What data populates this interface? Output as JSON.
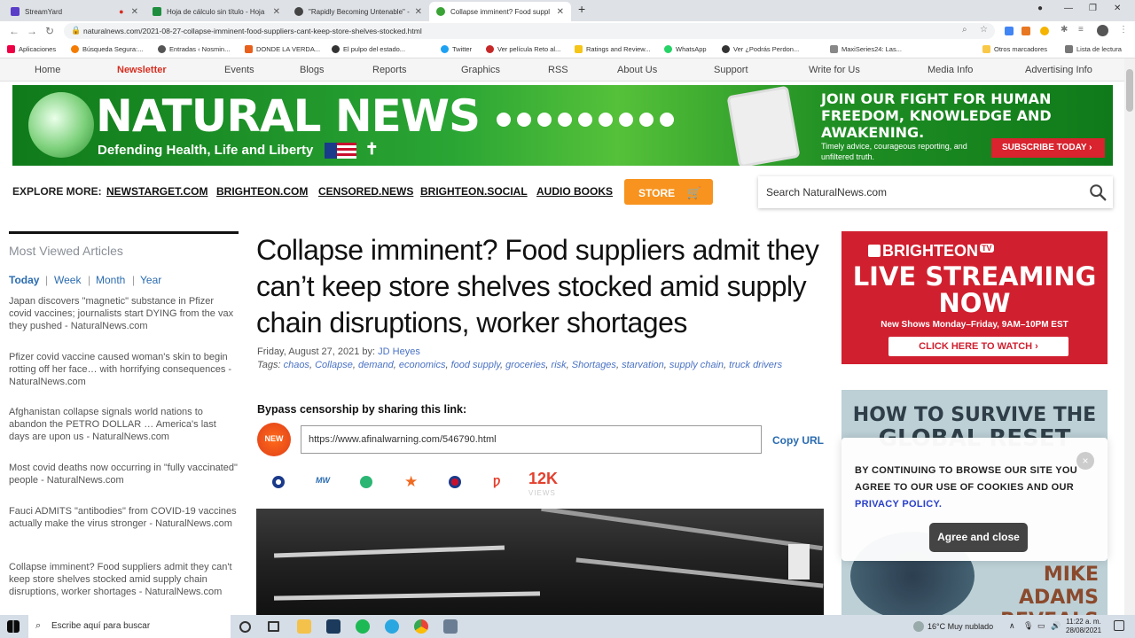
{
  "browser": {
    "tabs": [
      {
        "title": "StreamYard",
        "color": "#5a3ec8"
      },
      {
        "title": "Hoja de cálculo sin título - Hoja",
        "color": "#1e8e3e"
      },
      {
        "title": "\"Rapidly Becoming Untenable\" -",
        "color": "#444444"
      },
      {
        "title": "Collapse imminent? Food suppl",
        "color": "#3aa335"
      }
    ],
    "url": "naturalnews.com/2021-08-27-collapse-imminent-food-suppliers-cant-keep-store-shelves-stocked.html",
    "bookmarks": [
      "Aplicaciones",
      "Búsqueda Segura:...",
      "Entradas ‹ Nosmin...",
      "DONDE LA VERDA...",
      "El pulpo del estado...",
      "Twitter",
      "Ver película Reto al...",
      "Ratings and Review...",
      "WhatsApp",
      "Ver ¿Podrás Perdon...",
      "MaxiSeries24: Las...",
      "Otros marcadores",
      "Lista de lectura"
    ]
  },
  "site_nav": [
    "Home",
    "Newsletter",
    "Events",
    "Blogs",
    "Reports",
    "Graphics",
    "RSS",
    "About Us",
    "Support",
    "Write for Us",
    "Media Info",
    "Advertising Info"
  ],
  "banner": {
    "logo": "NATURAL NEWS",
    "tagline": "Defending Health, Life and Liberty",
    "promo_title": "JOIN OUR FIGHT FOR HUMAN FREEDOM, KNOWLEDGE AND AWAKENING.",
    "promo_sub": "Timely advice, courageous reporting, and unfiltered truth.",
    "subscribe": "SUBSCRIBE TODAY ›"
  },
  "explore": {
    "label": "EXPLORE MORE:",
    "links": [
      "NEWSTARGET.COM",
      "BRIGHTEON.COM",
      "CENSORED.NEWS",
      "BRIGHTEON.SOCIAL",
      "AUDIO BOOKS"
    ],
    "store": "STORE"
  },
  "search": {
    "placeholder": "Search NaturalNews.com"
  },
  "sidebar": {
    "title": "Most Viewed Articles",
    "tabs": [
      "Today",
      "Week",
      "Month",
      "Year"
    ],
    "items": [
      "Japan discovers \"magnetic\" substance in Pfizer covid vaccines; journalists start DYING from the vax they pushed - NaturalNews.com",
      "Pfizer covid vaccine caused woman's skin to begin rotting off her face… with horrifying consequences - NaturalNews.com",
      "Afghanistan collapse signals world nations to abandon the PETRO DOLLAR … America's last days are upon us - NaturalNews.com",
      "Most covid deaths now occurring in \"fully vaccinated\" people - NaturalNews.com",
      "Fauci ADMITS \"antibodies\" from COVID-19 vaccines actually make the virus stronger - NaturalNews.com",
      "Collapse imminent? Food suppliers admit they can't keep store shelves stocked amid supply chain disruptions, worker shortages - NaturalNews.com"
    ]
  },
  "article": {
    "headline": "Collapse imminent? Food suppliers admit they can’t keep store shelves stocked amid supply chain disruptions, worker shortages",
    "date": "Friday, August 27, 2021 by:",
    "author": "JD Heyes",
    "tags_label": "Tags:",
    "tags": [
      "chaos",
      "Collapse",
      "demand",
      "economics",
      "food supply",
      "groceries",
      "risk",
      "Shortages",
      "starvation",
      "supply chain",
      "truck drivers"
    ],
    "bypass": "Bypass censorship by sharing this link:",
    "new_badge": "NEW",
    "share_url": "https://www.afinalwarning.com/546790.html",
    "copy_url": "Copy URL",
    "views": "12K",
    "views_label": "VIEWS"
  },
  "ads": {
    "brighteon": {
      "brand": "BRIGHTEON",
      "tv": "TV",
      "live": "LIVE STREAMING NOW",
      "shows": "New Shows Monday–Friday, 9AM–10PM EST",
      "click": "CLICK HERE TO WATCH ›"
    },
    "reset": {
      "line1": "HOW TO SURVIVE THE",
      "line2": "GLOBAL RESET",
      "foot": "MIKE ADAMS REVEALS ALL"
    }
  },
  "cookie": {
    "text": "BY CONTINUING TO BROWSE OUR SITE YOU AGREE TO OUR USE OF COOKIES AND OUR",
    "link": "PRIVACY POLICY.",
    "agree": "Agree and close",
    "close": "×"
  },
  "taskbar": {
    "search": "Escribe aquí para buscar",
    "weather": "16°C  Muy nublado",
    "time": "11:22 a. m.",
    "date": "28/08/2021"
  }
}
